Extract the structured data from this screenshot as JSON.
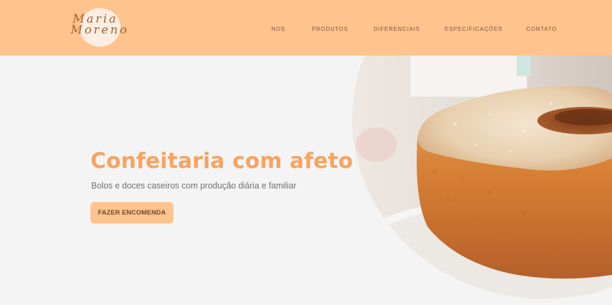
{
  "brand": {
    "logo_line1": "Maria",
    "logo_line2": "Moreno"
  },
  "nav": {
    "items": [
      {
        "label": "NOS"
      },
      {
        "label": "PRODUTOS"
      },
      {
        "label": "DIFERENCIAIS"
      },
      {
        "label": "ESPECIFICAÇÕES"
      },
      {
        "label": "CONTATO"
      }
    ]
  },
  "hero": {
    "title": "Confeitaria com afeto",
    "subtitle": "Bolos e doces caseiros com produção diária e familiar",
    "cta_label": "FAZER ENCOMENDA"
  },
  "colors": {
    "header_bg": "#ffc38d",
    "page_bg": "#f4f4f4",
    "title": "#f8a363",
    "button_bg": "#ffc38d",
    "nav_text": "#7a5235"
  }
}
